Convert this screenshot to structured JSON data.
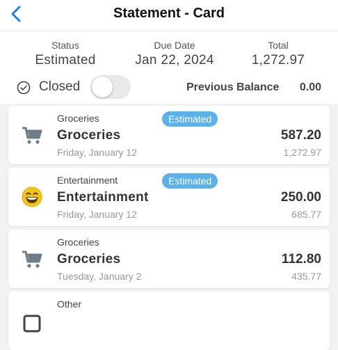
{
  "header": {
    "title": "Statement - Card",
    "back_icon": "chevron-left-icon"
  },
  "summary": {
    "status_label": "Status",
    "status_value": "Estimated",
    "due_label": "Due Date",
    "due_value": "Jan 22, 2024",
    "total_label": "Total",
    "total_value": "1,272.97",
    "closed_label": "Closed",
    "closed_on": false,
    "previous_balance_label": "Previous Balance",
    "previous_balance_value": "0.00"
  },
  "transactions": [
    {
      "category": "Groceries",
      "badge": "Estimated",
      "name": "Groceries",
      "date": "Friday, January 12",
      "amount": "587.20",
      "running": "1,272.97",
      "icon": "cart-icon"
    },
    {
      "category": "Entertainment",
      "badge": "Estimated",
      "name": "Entertainment",
      "date": "Friday, January 12",
      "amount": "250.00",
      "running": "685.77",
      "icon": "smiley-icon"
    },
    {
      "category": "Groceries",
      "badge": "",
      "name": "Groceries",
      "date": "Tuesday, January 2",
      "amount": "112.80",
      "running": "435.77",
      "icon": "cart-icon"
    },
    {
      "category": "Other",
      "badge": "",
      "name": "",
      "date": "",
      "amount": "",
      "running": "",
      "icon": "square-icon"
    }
  ],
  "colors": {
    "accent": "#1a7ff5",
    "badge": "#5bb2ea",
    "icon_gray": "#6f7d8a",
    "smiley": "#f5c518"
  }
}
